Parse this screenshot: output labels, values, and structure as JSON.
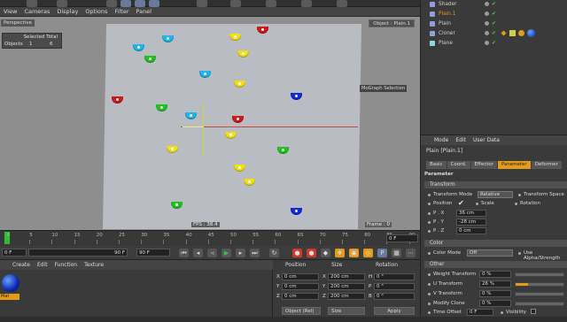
{
  "viewport": {
    "menu": [
      "View",
      "Cameras",
      "Display",
      "Options",
      "Filter",
      "Panel"
    ],
    "label": "Perspective",
    "object_label": "Object : Plain.1",
    "mograph_selection": "MoGraph Selection",
    "fps": "FPS : 38.4",
    "frame": "Frame : 0",
    "stats": {
      "header": "Selected Total",
      "objects_label": "Objects",
      "selected": "1",
      "total": "6"
    }
  },
  "timeline": {
    "ticks": [
      "0",
      "5",
      "10",
      "15",
      "20",
      "25",
      "30",
      "35",
      "40",
      "45",
      "50",
      "55",
      "60",
      "65",
      "70",
      "75",
      "80",
      "85",
      "90"
    ],
    "frame_field": "0 F"
  },
  "transport": {
    "start_field": "0 F",
    "end_field": "90 F",
    "end_field2": "90 F"
  },
  "material_manager": {
    "menu": [
      "Create",
      "Edit",
      "Function",
      "Texture"
    ],
    "material_name": "Mat"
  },
  "coordinates": {
    "headers": {
      "position": "Position",
      "size": "Size",
      "rotation": "Rotation"
    },
    "rows": [
      {
        "axis": "X",
        "pos": "0 cm",
        "size_axis": "X",
        "size": "200 cm",
        "rot_axis": "H",
        "rot": "0 °"
      },
      {
        "axis": "Y",
        "pos": "0 cm",
        "size_axis": "Y",
        "size": "200 cm",
        "rot_axis": "P",
        "rot": "0 °"
      },
      {
        "axis": "Z",
        "pos": "0 cm",
        "size_axis": "Z",
        "size": "200 cm",
        "rot_axis": "B",
        "rot": "0 °"
      }
    ],
    "mode_select": "Object (Rel)",
    "size_select": "Size",
    "apply_label": "Apply"
  },
  "object_manager": {
    "items": [
      {
        "name": "Shader",
        "color": "#8fa0d8",
        "active": false
      },
      {
        "name": "Plain.1",
        "color": "#8fa0d8",
        "active": true
      },
      {
        "name": "Plain",
        "color": "#8fa0d8",
        "active": false
      },
      {
        "name": "Cloner",
        "color": "#8fa0d8",
        "active": false
      },
      {
        "name": "Plane",
        "color": "#8fd8e0",
        "active": false
      }
    ]
  },
  "attributes": {
    "menu": [
      "Mode",
      "Edit",
      "User Data"
    ],
    "title": "Plain [Plain.1]",
    "tabs": [
      "Basic",
      "Coord.",
      "Effector",
      "Parameter",
      "Deformer"
    ],
    "active_tab": "Parameter",
    "parameter_heading": "Parameter",
    "transform_section": "Transform",
    "transform_mode_label": "Transform Mode",
    "transform_mode_value": "Relative",
    "transform_space_label": "Transform Space",
    "position_label": "Position",
    "scale_label": "Scale",
    "rotation_label": "Rotation",
    "px_label": "P . X",
    "px_value": "36 cm",
    "py_label": "P . Y",
    "py_value": "-28 cm",
    "pz_label": "P . Z",
    "pz_value": "0 cm",
    "color_section": "Color",
    "color_mode_label": "Color Mode",
    "color_mode_value": "Off",
    "use_alpha_label": "Use Alpha/Strength",
    "other_section": "Other",
    "weight_label": "Weight Transform",
    "weight_value": "0 %",
    "weight_level": 0,
    "u_label": "U Transform",
    "u_value": "26 %",
    "u_level": 0.26,
    "v_label": "V Transform",
    "v_value": "0 %",
    "v_level": 0,
    "modify_label": "Modify Clone",
    "modify_value": "0 %",
    "modify_level": 0,
    "time_offset_label": "Time Offset",
    "time_offset_value": "0 F",
    "visibility_label": "Visibility"
  }
}
